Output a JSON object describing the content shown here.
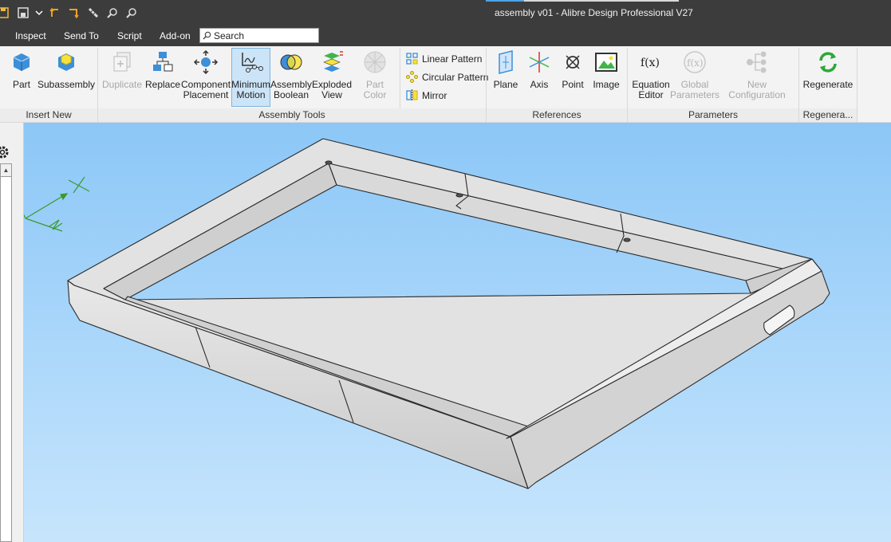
{
  "titlebar": {
    "title": "assembly v01 - Alibre Design Professional V27",
    "quick_access_icons": [
      "save-icon",
      "save-all-icon",
      "dropdown-icon",
      "undo-icon",
      "redo-icon",
      "measure-icon",
      "zoom-icon",
      "zoom-fit-icon"
    ]
  },
  "menu": {
    "items": [
      "Inspect",
      "Send To",
      "Script",
      "Add-on"
    ],
    "search_placeholder": "Search"
  },
  "ribbon": {
    "tools": {
      "part": "Part",
      "subassembly": "Subassembly",
      "duplicate": "Duplicate",
      "replace": "Replace",
      "component_placement_1": "Component",
      "component_placement_2": "Placement",
      "minimum_motion_1": "Minimum",
      "minimum_motion_2": "Motion",
      "assembly_boolean_1": "Assembly",
      "assembly_boolean_2": "Boolean",
      "exploded_view_1": "Exploded",
      "exploded_view_2": "View",
      "part_color": "Part Color",
      "linear_pattern": "Linear Pattern",
      "circular_pattern": "Circular Pattern",
      "mirror": "Mirror",
      "plane": "Plane",
      "axis": "Axis",
      "point": "Point",
      "image": "Image",
      "equation_editor_1": "Equation",
      "equation_editor_2": "Editor",
      "global_parameters_1": "Global",
      "global_parameters_2": "Parameters",
      "new_configuration": "New Configuration",
      "regenerate": "Regenerate"
    },
    "groups": {
      "insert_new": "Insert New",
      "assembly_tools": "Assembly Tools",
      "references": "References",
      "parameters": "Parameters",
      "regenerate": "Regenera..."
    }
  },
  "colors": {
    "title_bg": "#3c3c3c",
    "ribbon_bg": "#f3f3f3",
    "viewport_top": "#8cc7f7",
    "viewport_bottom": "#c7e5fc",
    "selected_tool": "#cce4f7",
    "model_face": "#d7d7d7",
    "triad": "#3a9a2a"
  }
}
